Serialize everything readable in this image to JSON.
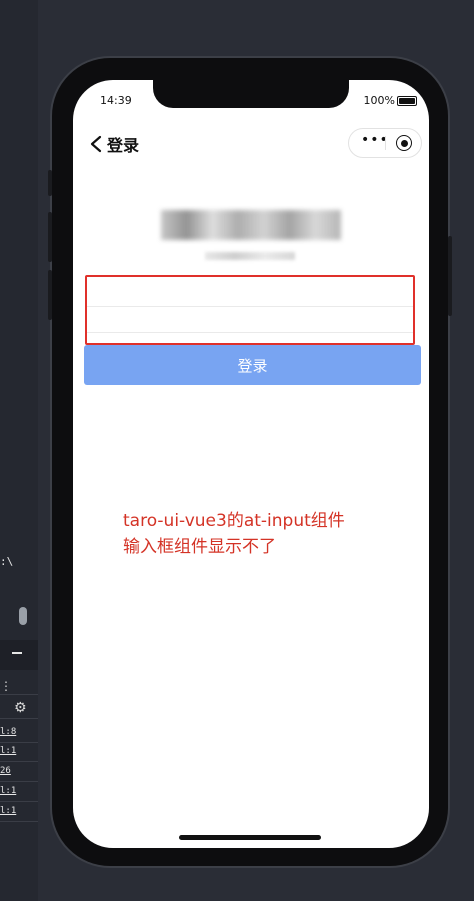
{
  "editor": {
    "path_text": ":\\",
    "rows": [
      "l:8",
      "l:1",
      "26",
      "l:1",
      "l:1"
    ]
  },
  "status_bar": {
    "time": "14:39",
    "battery": "100%"
  },
  "nav": {
    "title": "登录"
  },
  "form": {
    "login_button": "登录"
  },
  "annotation": {
    "line1": "taro-ui-vue3的at-input组件",
    "line2": "输入框组件显示不了"
  },
  "colors": {
    "highlight": "#e0302a",
    "button": "#78a4f2",
    "annotation": "#d43326"
  }
}
